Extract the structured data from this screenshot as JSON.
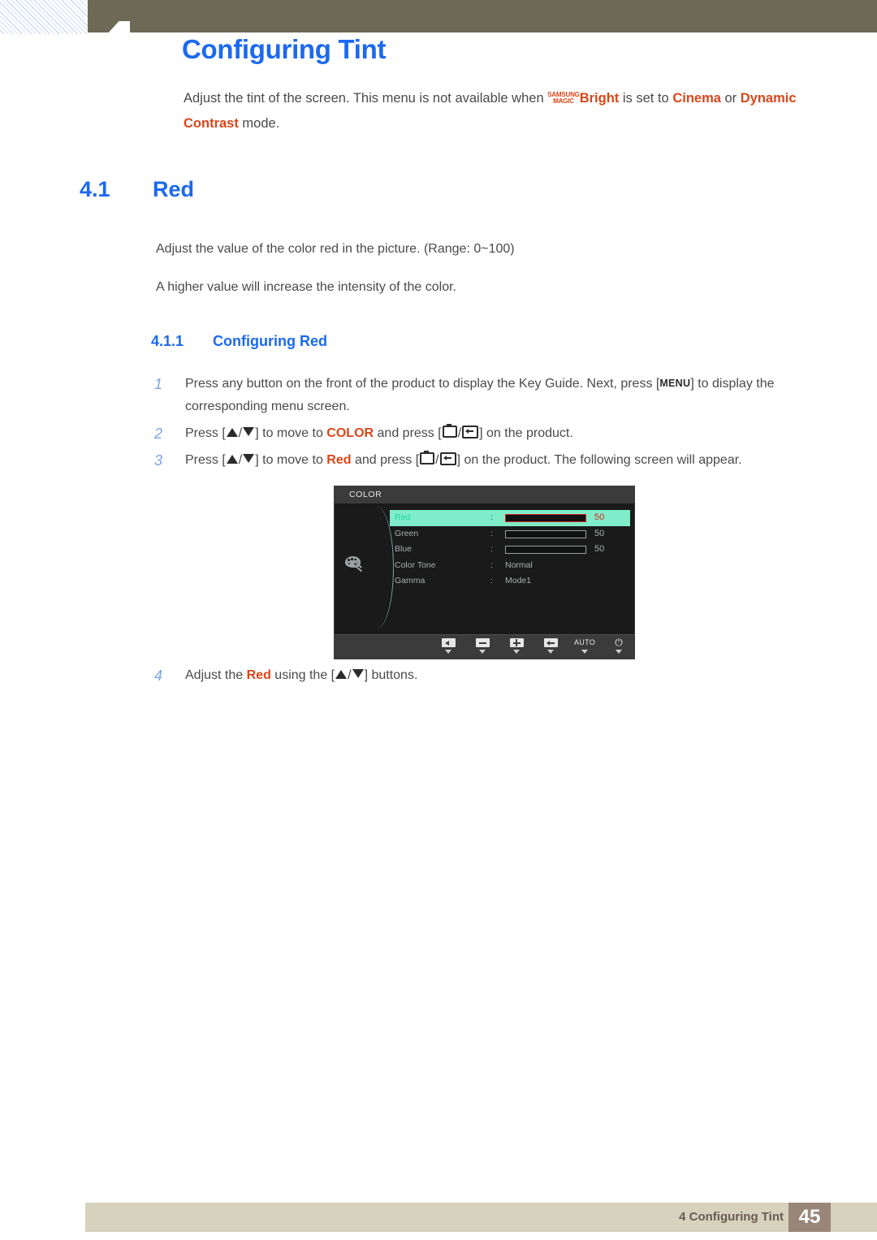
{
  "header": {
    "chapter_number": "4",
    "page_title": "Configuring Tint"
  },
  "intro": {
    "text_before": "Adjust the tint of the screen. This menu is not available when ",
    "magic_top": "SAMSUNG",
    "magic_bottom": "MAGIC",
    "bright_label": "Bright",
    "text_mid": " is set to ",
    "mode_cinema": "Cinema",
    "text_or": " or ",
    "mode_dynamic": "Dynamic Contrast",
    "text_after": " mode."
  },
  "section": {
    "number": "4.1",
    "title": "Red",
    "paragraph_1": "Adjust the value of the color red in the picture. (Range: 0~100)",
    "paragraph_2": "A higher value will increase the intensity of the color."
  },
  "subsection": {
    "number": "4.1.1",
    "title": "Configuring Red"
  },
  "steps": {
    "step1": {
      "number": "1",
      "part_a": "Press any button on the front of the product to display the Key Guide. Next, press [",
      "key_menu": "MENU",
      "part_b": "] to display the corresponding menu screen."
    },
    "step2": {
      "number": "2",
      "part_a": "Press [",
      "part_b": "] to move to ",
      "target": "COLOR",
      "part_c": " and press [",
      "part_d": "] on the product."
    },
    "step3": {
      "number": "3",
      "part_a": "Press [",
      "part_b": "] to move to ",
      "target": "Red",
      "part_c": " and press [",
      "part_d": "] on the product. The following screen will appear."
    },
    "step4": {
      "number": "4",
      "part_a": "Adjust the ",
      "target": "Red",
      "part_b": " using the [",
      "part_c": "] buttons."
    }
  },
  "osd": {
    "title": "COLOR",
    "rows": [
      {
        "label": "Red",
        "colon": ":",
        "type": "slider",
        "value": "50",
        "fill_percent": 50,
        "active": true
      },
      {
        "label": "Green",
        "colon": ":",
        "type": "slider",
        "value": "50",
        "fill_percent": 50,
        "active": false
      },
      {
        "label": "Blue",
        "colon": ":",
        "type": "slider",
        "value": "50",
        "fill_percent": 50,
        "active": false
      },
      {
        "label": "Color Tone",
        "colon": ":",
        "type": "text",
        "value": "Normal",
        "active": false
      },
      {
        "label": "Gamma",
        "colon": ":",
        "type": "text",
        "value": "Mode1",
        "active": false
      }
    ],
    "buttons": [
      {
        "icon": "left-arrow-button",
        "label": ""
      },
      {
        "icon": "minus-button",
        "label": ""
      },
      {
        "icon": "plus-button",
        "label": ""
      },
      {
        "icon": "enter-button",
        "label": ""
      },
      {
        "icon": "auto-button",
        "label": "AUTO"
      },
      {
        "icon": "power-button",
        "label": "⏻"
      }
    ]
  },
  "footer": {
    "text": "4 Configuring Tint",
    "page_number": "45"
  },
  "colors": {
    "heading_blue": "#1b69f0",
    "accent_orange": "#d9471a",
    "olive_bar": "#6c6a55",
    "footer_bar": "#d7d2bd",
    "footer_page_box": "#9a8678",
    "osd_highlight": "#7fedc9",
    "osd_red": "#ff0000"
  }
}
